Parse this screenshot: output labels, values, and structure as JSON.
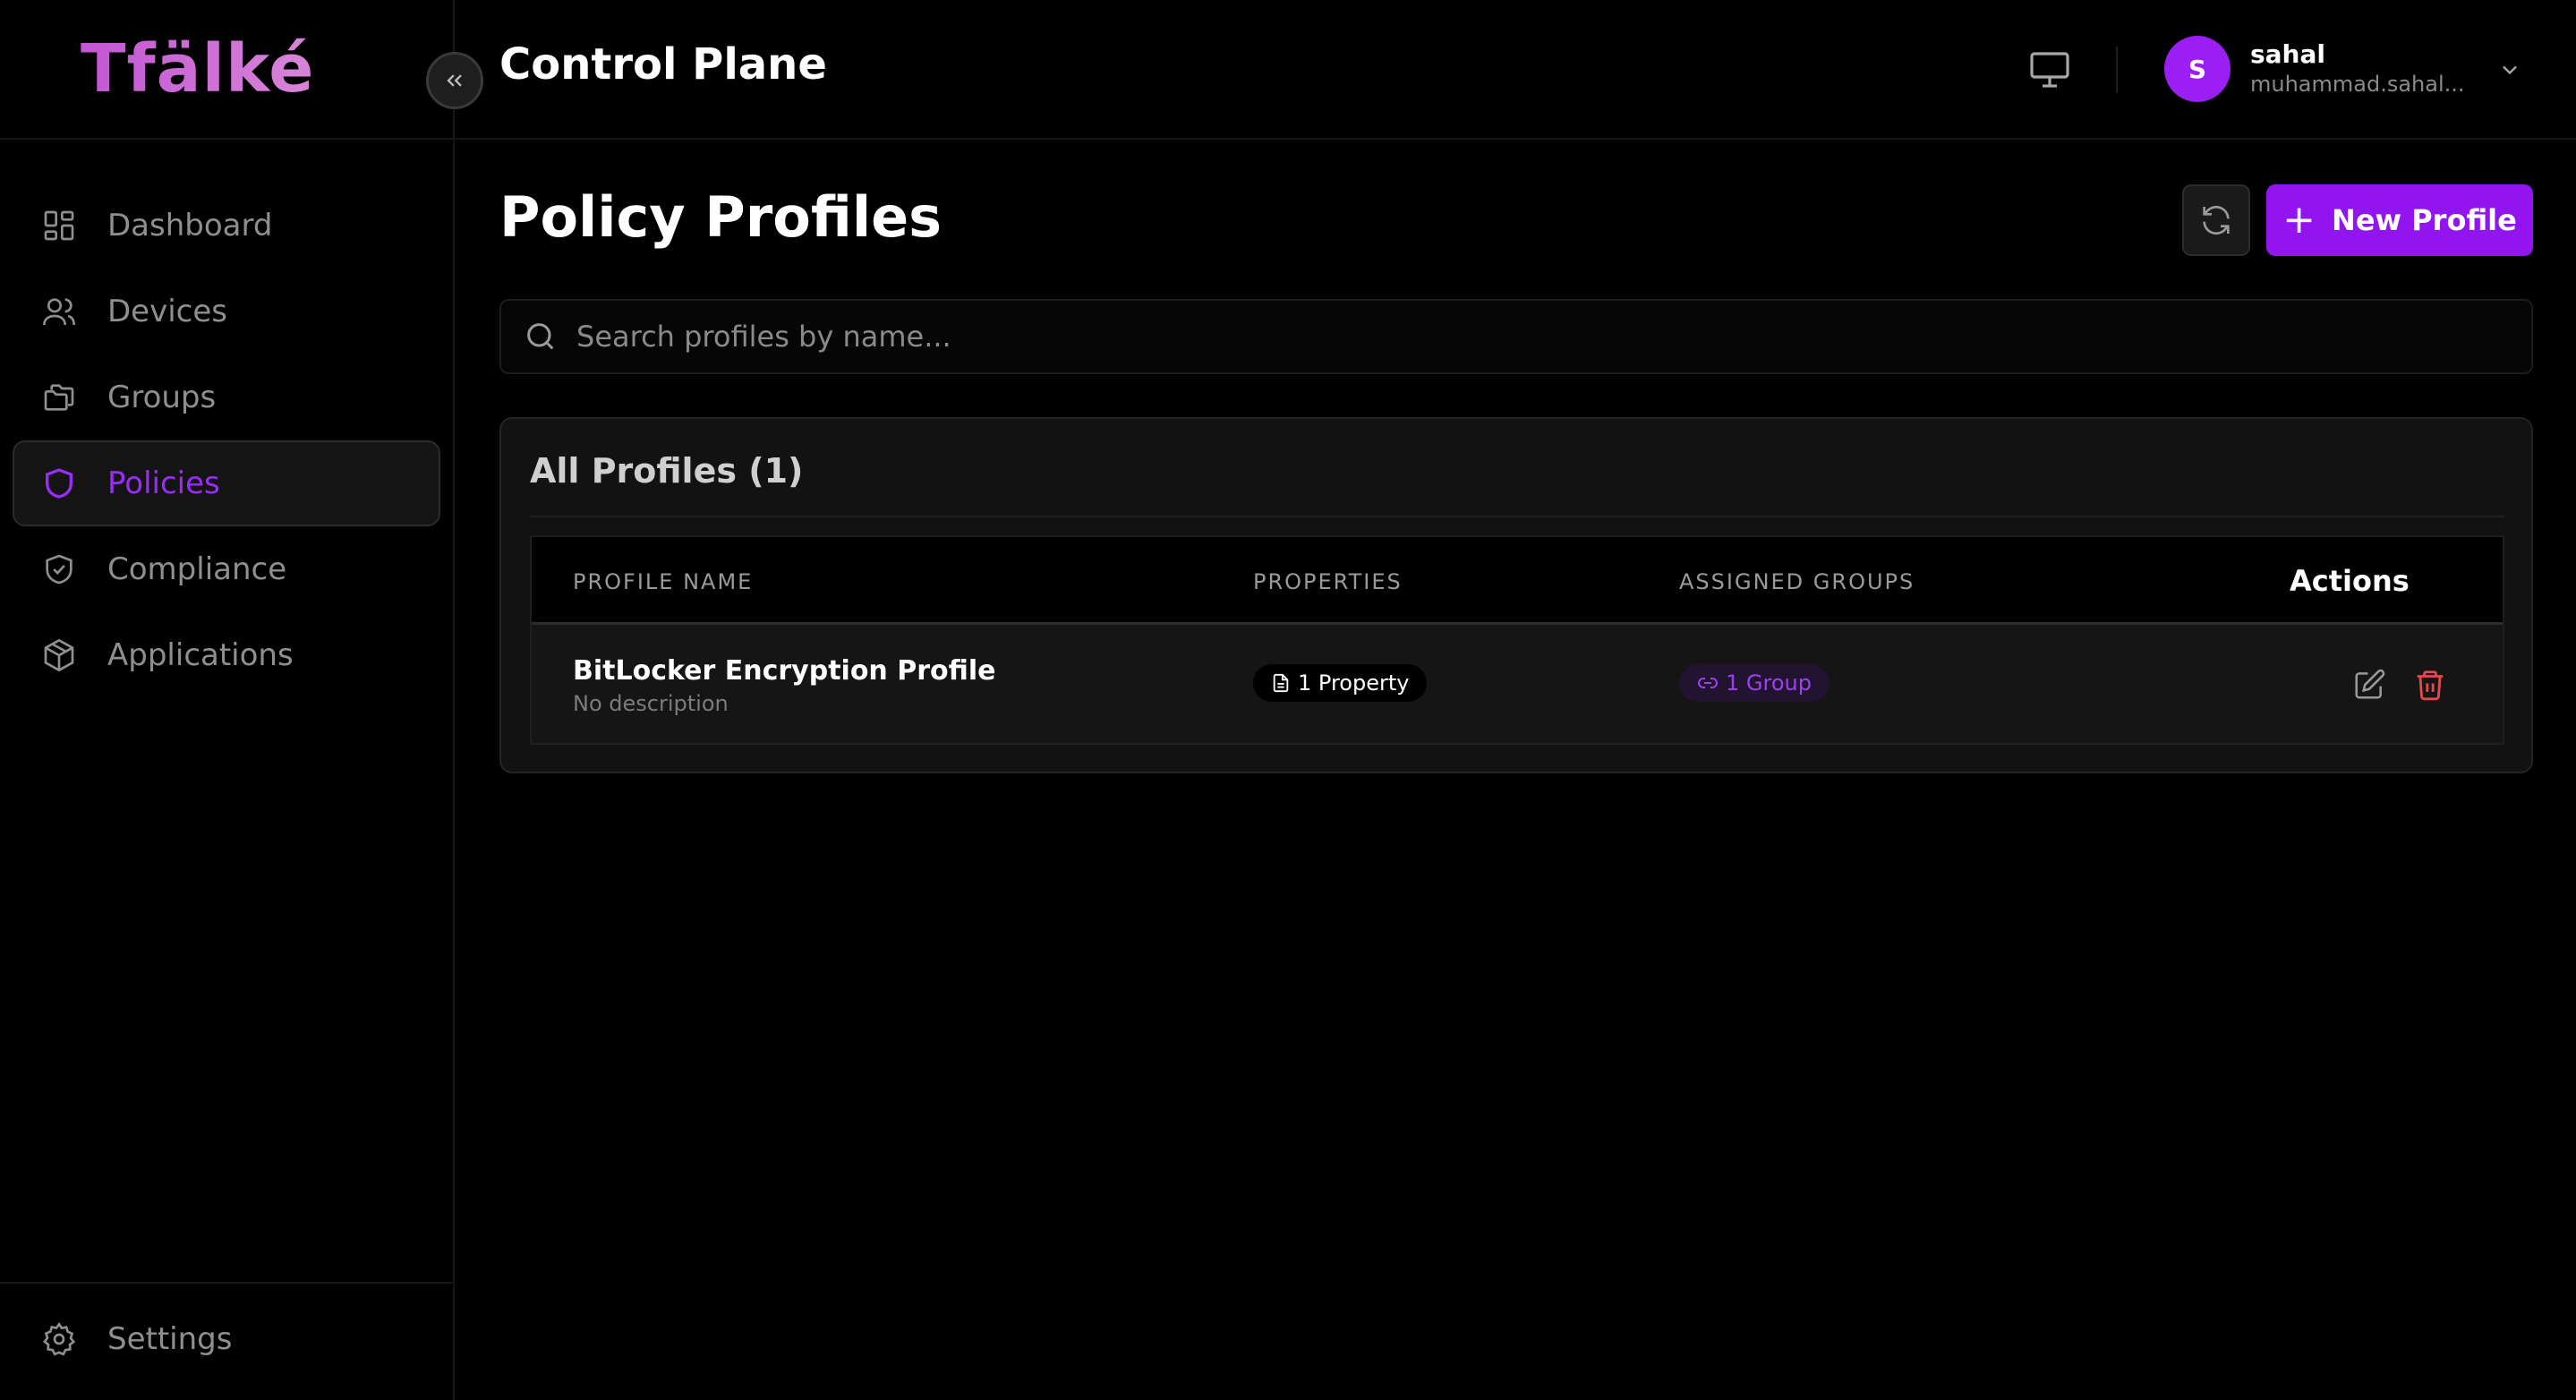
{
  "app": {
    "logo": "Tfälké",
    "title": "Control Plane"
  },
  "sidebar": {
    "items": [
      {
        "label": "Dashboard",
        "icon": "dashboard-grid-icon",
        "active": false
      },
      {
        "label": "Devices",
        "icon": "users-icon",
        "active": false
      },
      {
        "label": "Groups",
        "icon": "folders-icon",
        "active": false
      },
      {
        "label": "Policies",
        "icon": "shield-icon",
        "active": true
      },
      {
        "label": "Compliance",
        "icon": "shield-check-icon",
        "active": false
      },
      {
        "label": "Applications",
        "icon": "package-icon",
        "active": false
      }
    ],
    "settings_label": "Settings"
  },
  "header": {
    "user": {
      "initial": "S",
      "name": "sahal",
      "email": "muhammad.sahal..."
    }
  },
  "main": {
    "title": "Policy Profiles",
    "new_button": "New Profile",
    "search_placeholder": "Search profiles by name...",
    "card_title": "All Profiles (1)",
    "columns": [
      "PROFILE NAME",
      "PROPERTIES",
      "ASSIGNED GROUPS",
      "Actions"
    ],
    "rows": [
      {
        "name": "BitLocker Encryption Profile",
        "description": "No description",
        "properties": "1 Property",
        "groups": "1 Group"
      }
    ]
  },
  "colors": {
    "accent": "#9215f0",
    "active_nav": "#9b2cf6",
    "delete": "#e5484d",
    "background": "#000000"
  }
}
